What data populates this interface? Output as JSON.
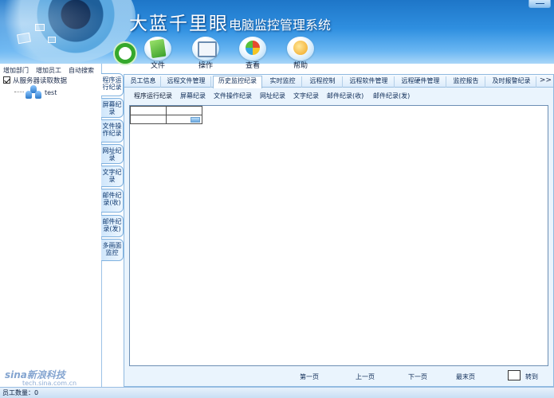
{
  "app": {
    "title_main": "大蓝千里眼",
    "title_sub": "电脑监控管理系统"
  },
  "toolbar": [
    {
      "label": "文件",
      "icon": "file-icon"
    },
    {
      "label": "操作",
      "icon": "operation-icon"
    },
    {
      "label": "查看",
      "icon": "view-icon"
    },
    {
      "label": "帮助",
      "icon": "help-icon"
    }
  ],
  "left_panel": {
    "actions": [
      "增加部门",
      "增加员工",
      "自动搜索"
    ],
    "checkbox_label": "从服务器读取数据",
    "tree_node": "test"
  },
  "vertical_tabs": [
    "程序运行纪录",
    "屏幕纪录",
    "文件操作纪录",
    "网址纪录",
    "文字纪录",
    "邮件纪录(收)",
    "邮件纪录(发)",
    "多画面监控"
  ],
  "main_tabs": [
    "员工信息",
    "远程文件管理",
    "历史监控纪录",
    "实时监控",
    "远程控制",
    "远程软件管理",
    "远程硬件管理",
    "监控报告",
    "及时报警纪录"
  ],
  "main_tabs_more": ">>",
  "sub_tabs": [
    "程序运行纪录",
    "屏幕纪录",
    "文件操作纪录",
    "网址纪录",
    "文字纪录",
    "邮件纪录(收)",
    "邮件纪录(发)"
  ],
  "pager": {
    "first": "第一页",
    "prev": "上一页",
    "next": "下一页",
    "last": "最末页",
    "goto": "转到"
  },
  "status": {
    "employee_count": "员工数量：0"
  },
  "watermark": {
    "brand": "sina新浪科技",
    "url": "tech.sina.com.cn"
  },
  "colors": {
    "banner": "#2f8fe0",
    "panel_bg": "#eaf4fd",
    "border": "#8fb9e0"
  }
}
